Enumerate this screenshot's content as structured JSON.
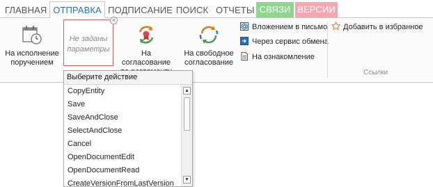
{
  "tabs": [
    {
      "label": "ГЛАВНАЯ"
    },
    {
      "label": "ОТПРАВКА"
    },
    {
      "label": "ПОДПИСАНИЕ"
    },
    {
      "label": "ПОИСК"
    },
    {
      "label": "ОТЧЕТЫ"
    },
    {
      "label": "СВЯЗИ"
    },
    {
      "label": "ВЕРСИИ"
    }
  ],
  "active_tab": "ОТПРАВКА",
  "colors": {
    "tab_links": "#8fd48f",
    "tab_versions": "#f2a8b0",
    "param_border": "#e05a5a",
    "accent_orange": "#e07a20",
    "accent_green": "#3aa04a",
    "accent_blue": "#2a7ad0"
  },
  "ribbon": {
    "execute_button": {
      "label": "На исполнение поручением",
      "icon": "calendar-clock-icon"
    },
    "params_placeholder": "Не заданы параметры",
    "approve_regulation_button": {
      "label": "На согласование по регламенту",
      "icon": "cycle-seal-icon"
    },
    "approve_free_button": {
      "label": "На свободное согласование",
      "icon": "cycle-arrows-icon"
    },
    "small_buttons": [
      {
        "label": "Вложением в письмо",
        "icon": "at-mail-icon"
      },
      {
        "label": "Через сервис обмена",
        "icon": "exchange-icon"
      },
      {
        "label": "На ознакомление",
        "icon": "document-icon"
      }
    ],
    "favorites_button": {
      "label": "Добавить в избранное",
      "icon": "star-icon"
    },
    "group_label": "Ссылки"
  },
  "dropdown": {
    "header": "Выберите действие",
    "items": [
      "CopyEntity",
      "Save",
      "SaveAndClose",
      "SelectAndClose",
      "Cancel",
      "OpenDocumentEdit",
      "OpenDocumentRead",
      "CreateVersionFromLastVersion"
    ]
  }
}
